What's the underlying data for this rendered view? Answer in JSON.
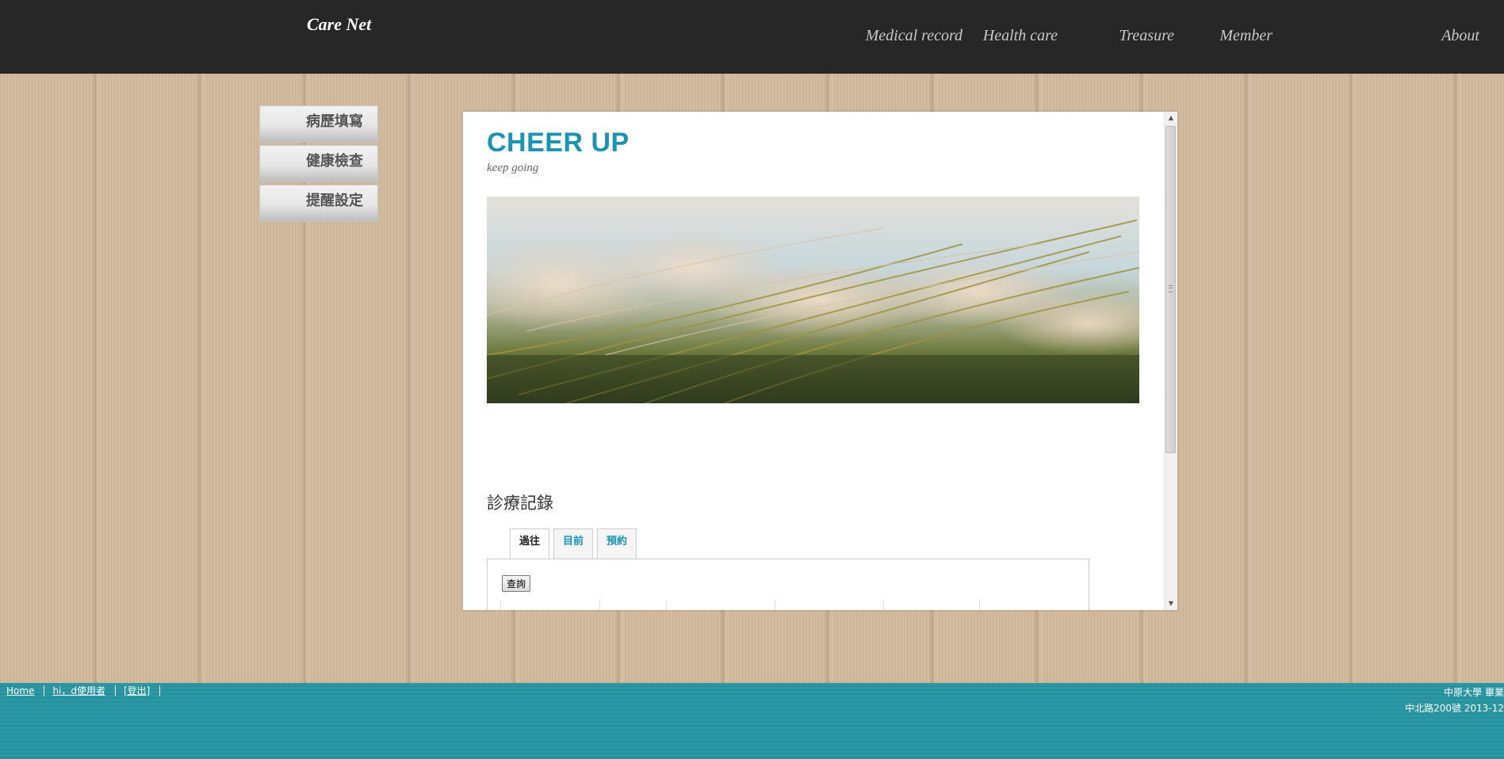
{
  "header": {
    "brand": "Care Net",
    "nav": [
      {
        "label": "Medical record"
      },
      {
        "label": "Health care"
      },
      {
        "label": "Treasure"
      },
      {
        "label": "Member"
      },
      {
        "label": "About"
      }
    ]
  },
  "sidebar": {
    "items": [
      {
        "label": "病歷填寫"
      },
      {
        "label": "健康檢查"
      },
      {
        "label": "提醒設定"
      }
    ]
  },
  "content": {
    "title": "CHEER UP",
    "subtitle": "keep going",
    "section_title": "診療記錄",
    "tabs": [
      {
        "label": "過往",
        "active": true
      },
      {
        "label": "目前",
        "active": false
      },
      {
        "label": "預約",
        "active": false
      }
    ],
    "query_button": "查詢"
  },
  "footer": {
    "links": [
      {
        "label": "Home"
      },
      {
        "label": "hi，d使用者"
      },
      {
        "label": "[登出]"
      }
    ],
    "right_line1": "中原大學 畢業",
    "right_line2": "中北路200號 2013-12"
  },
  "colors": {
    "header_bg": "#272727",
    "accent": "#1a94b5",
    "footer_bg": "#2a98a6"
  }
}
